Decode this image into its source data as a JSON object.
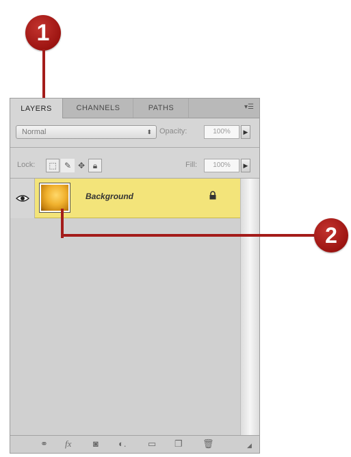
{
  "callouts": [
    "1",
    "2"
  ],
  "panel": {
    "tabs": [
      {
        "label": "LAYERS",
        "active": true
      },
      {
        "label": "CHANNELS",
        "active": false
      },
      {
        "label": "PATHS",
        "active": false
      }
    ],
    "menu_icon": "panel-menu-icon",
    "blend_mode": "Normal",
    "opacity_label": "Opacity:",
    "opacity_value": "100%",
    "lock_label": "Lock:",
    "fill_label": "Fill:",
    "fill_value": "100%",
    "lock_icons": [
      "lock-transparent-pixels-icon",
      "lock-image-pixels-icon",
      "lock-position-icon",
      "lock-all-icon"
    ],
    "layers": [
      {
        "name": "Background",
        "visible": true,
        "locked": true,
        "selected": true
      }
    ],
    "bottom_icons": [
      "link-layers-icon",
      "fx-icon",
      "layer-mask-icon",
      "adjustment-layer-icon",
      "new-group-icon",
      "new-layer-icon",
      "trash-icon"
    ]
  },
  "colors": {
    "callout": "#9c1411",
    "selected_layer": "#f3e47a",
    "panel_bg": "#d6d6d6"
  }
}
